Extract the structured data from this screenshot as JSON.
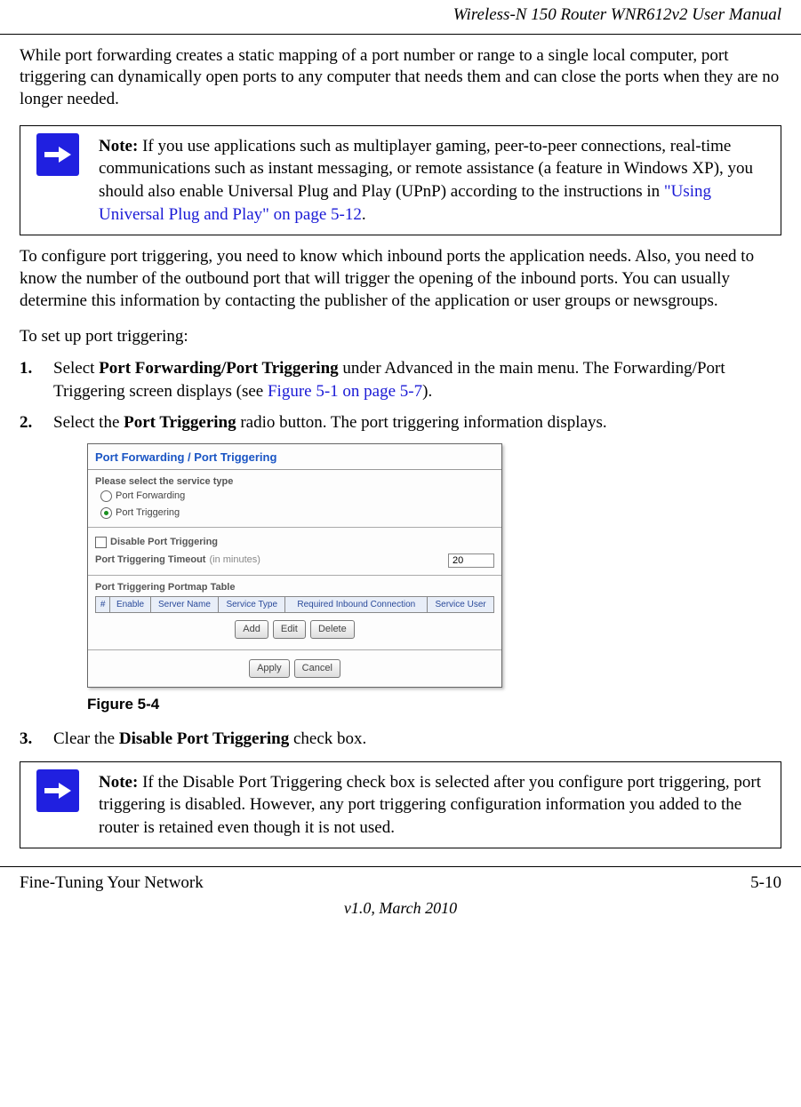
{
  "header_title": "Wireless-N 150 Router WNR612v2 User Manual",
  "intro_para": "While port forwarding creates a static mapping of a port number or range to a single local computer, port triggering can dynamically open ports to any computer that needs them and can close the ports when they are no longer needed.",
  "note1": {
    "label": "Note:",
    "text_part1": " If you use applications such as multiplayer gaming, peer-to-peer connections, real-time communications such as instant messaging, or remote assistance (a feature in Windows XP), you should also enable Universal Plug and Play (UPnP) according to the instructions in ",
    "link": "\"Using Universal Plug and Play\" on page 5-12",
    "text_part2": "."
  },
  "para2": "To configure port triggering, you need to know which inbound ports the application needs. Also, you need to know the number of the outbound port that will trigger the opening of the inbound ports. You can usually determine this information by contacting the publisher of the application or user groups or newsgroups.",
  "para3": "To set up port triggering:",
  "step1": {
    "num": "1.",
    "pre": "Select ",
    "bold": "Port Forwarding/Port Triggering",
    "mid": " under Advanced in the main menu. The Forwarding/Port Triggering screen displays (see ",
    "link": "Figure 5-1 on page 5-7",
    "post": ")."
  },
  "step2": {
    "num": "2.",
    "pre": "Select the ",
    "bold": "Port Triggering",
    "post": " radio button. The port triggering information displays."
  },
  "screenshot": {
    "title": "Port Forwarding / Port Triggering",
    "service_type_label": "Please select the service type",
    "radio1": "Port Forwarding",
    "radio2": "Port Triggering",
    "disable_label": "Disable Port Triggering",
    "timeout_label": "Port Triggering Timeout",
    "timeout_unit": "(in minutes)",
    "timeout_value": "20",
    "portmap_label": "Port Triggering Portmap Table",
    "headers": [
      "#",
      "Enable",
      "Server Name",
      "Service Type",
      "Required Inbound Connection",
      "Service User"
    ],
    "btn_add": "Add",
    "btn_edit": "Edit",
    "btn_delete": "Delete",
    "btn_apply": "Apply",
    "btn_cancel": "Cancel"
  },
  "figure_caption": "Figure 5-4",
  "step3": {
    "num": "3.",
    "pre": "Clear the ",
    "bold": "Disable Port Triggering",
    "post": " check box."
  },
  "note2": {
    "label": "Note:",
    "text": " If the Disable Port Triggering check box is selected after you configure port triggering, port triggering is disabled. However, any port triggering configuration information you added to the router is retained even though it is not used."
  },
  "footer_left": "Fine-Tuning Your Network",
  "footer_right": "5-10",
  "footer_version": "v1.0, March 2010"
}
